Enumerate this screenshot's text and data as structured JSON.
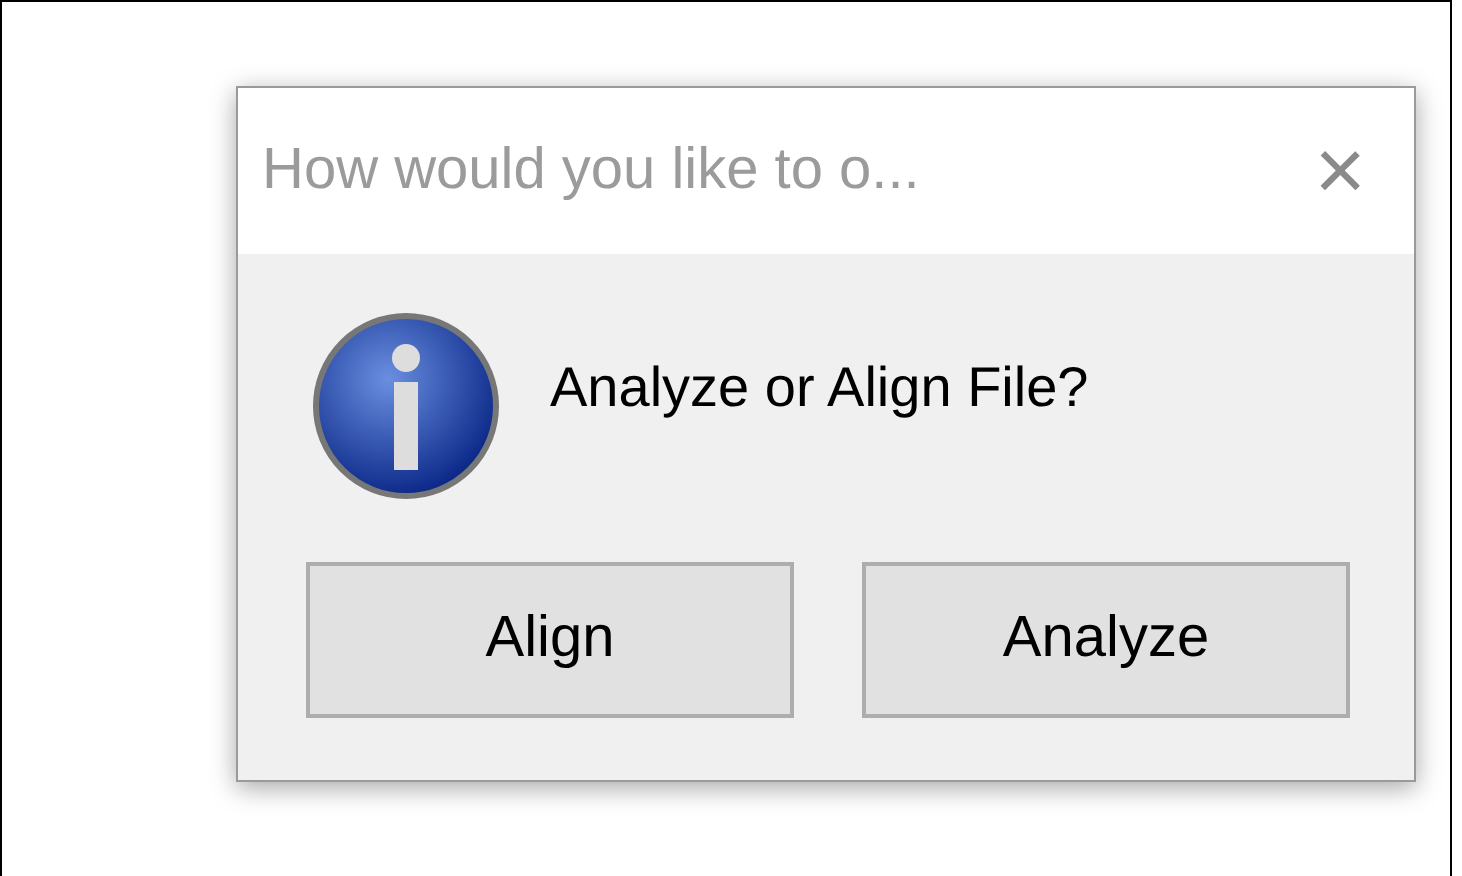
{
  "window": {
    "title": "How would you like to o...",
    "close": "×"
  },
  "message": "Analyze or Align File?",
  "buttons": [
    {
      "label": "Align",
      "selected": false
    },
    {
      "label": "Analyze",
      "selected": false
    }
  ]
}
